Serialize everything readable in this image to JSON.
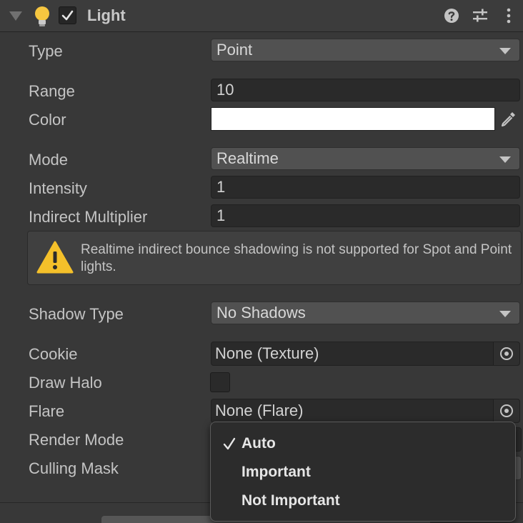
{
  "header": {
    "title": "Light",
    "enabled": true
  },
  "properties": {
    "type": {
      "label": "Type",
      "value": "Point"
    },
    "range": {
      "label": "Range",
      "value": "10"
    },
    "color": {
      "label": "Color",
      "value": "#ffffff"
    },
    "mode": {
      "label": "Mode",
      "value": "Realtime"
    },
    "intensity": {
      "label": "Intensity",
      "value": "1"
    },
    "indirect_multiplier": {
      "label": "Indirect Multiplier",
      "value": "1"
    },
    "warning": "Realtime indirect bounce shadowing is not supported for Spot and Point lights.",
    "shadow_type": {
      "label": "Shadow Type",
      "value": "No Shadows"
    },
    "cookie": {
      "label": "Cookie",
      "value": "None (Texture)"
    },
    "draw_halo": {
      "label": "Draw Halo",
      "checked": false
    },
    "flare": {
      "label": "Flare",
      "value": "None (Flare)"
    },
    "render_mode": {
      "label": "Render Mode"
    },
    "culling_mask": {
      "label": "Culling Mask"
    }
  },
  "render_mode_menu": {
    "items": [
      "Auto",
      "Important",
      "Not Important"
    ],
    "selected": "Auto"
  },
  "colors": {
    "warning_icon": "#f4c02a",
    "bulb": "#f6c640"
  }
}
